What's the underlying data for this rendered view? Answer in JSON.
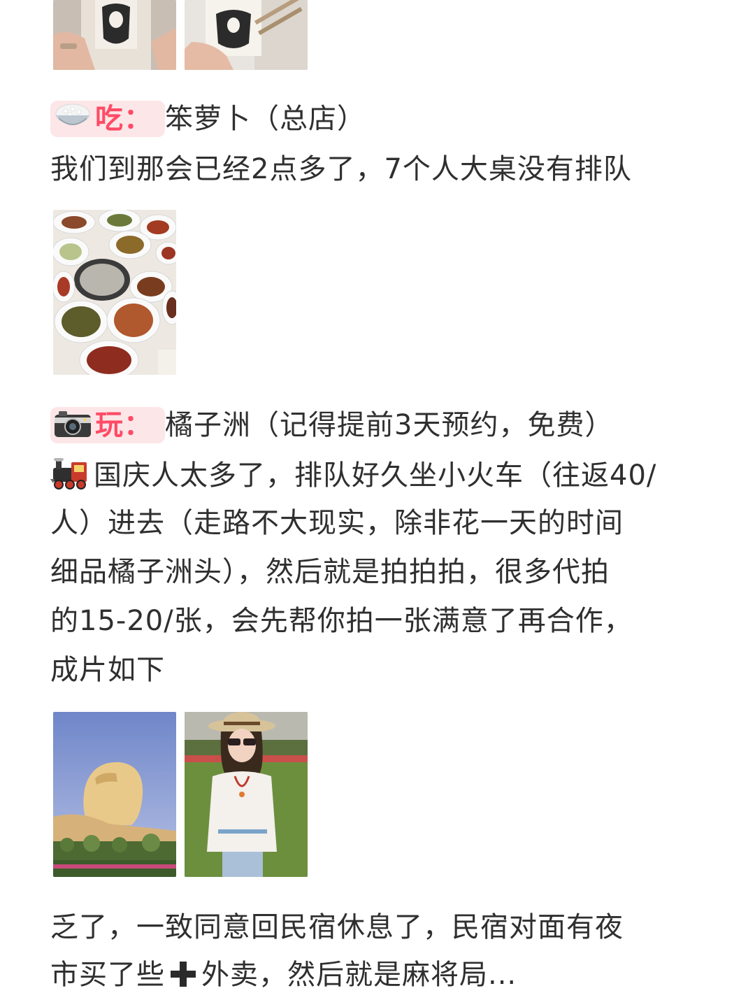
{
  "section_eat": {
    "tag_label": "吃：",
    "title": "笨萝卜（总店）",
    "desc": "我们到那会已经2点多了，7个人大桌没有排队"
  },
  "section_play": {
    "tag_label": "玩：",
    "title": "橘子洲（记得提前3天预约，免费）",
    "lines": [
      "国庆人太多了，排队好久坐小火车（往返40/",
      "人）进去（走路不大现实，除非花一天的时间",
      "细品橘子洲头），然后就是拍拍拍，很多代拍",
      "的15-20/张，会先帮你拍一张满意了再合作，",
      "成片如下"
    ]
  },
  "footer": {
    "line1": "乏了，一致同意回民宿休息了，民宿对面有夜",
    "line2_a": "市买了些",
    "line2_b": "外卖，然后就是麻将局..."
  },
  "icons": {
    "eat": "rice-bowl-icon",
    "play": "camera-icon",
    "train": "train-icon",
    "plus": "plus-icon"
  },
  "colors": {
    "tag_text": "#ff4b66",
    "tag_bg": "#fde6e8",
    "body_text": "#2f2f2f"
  }
}
